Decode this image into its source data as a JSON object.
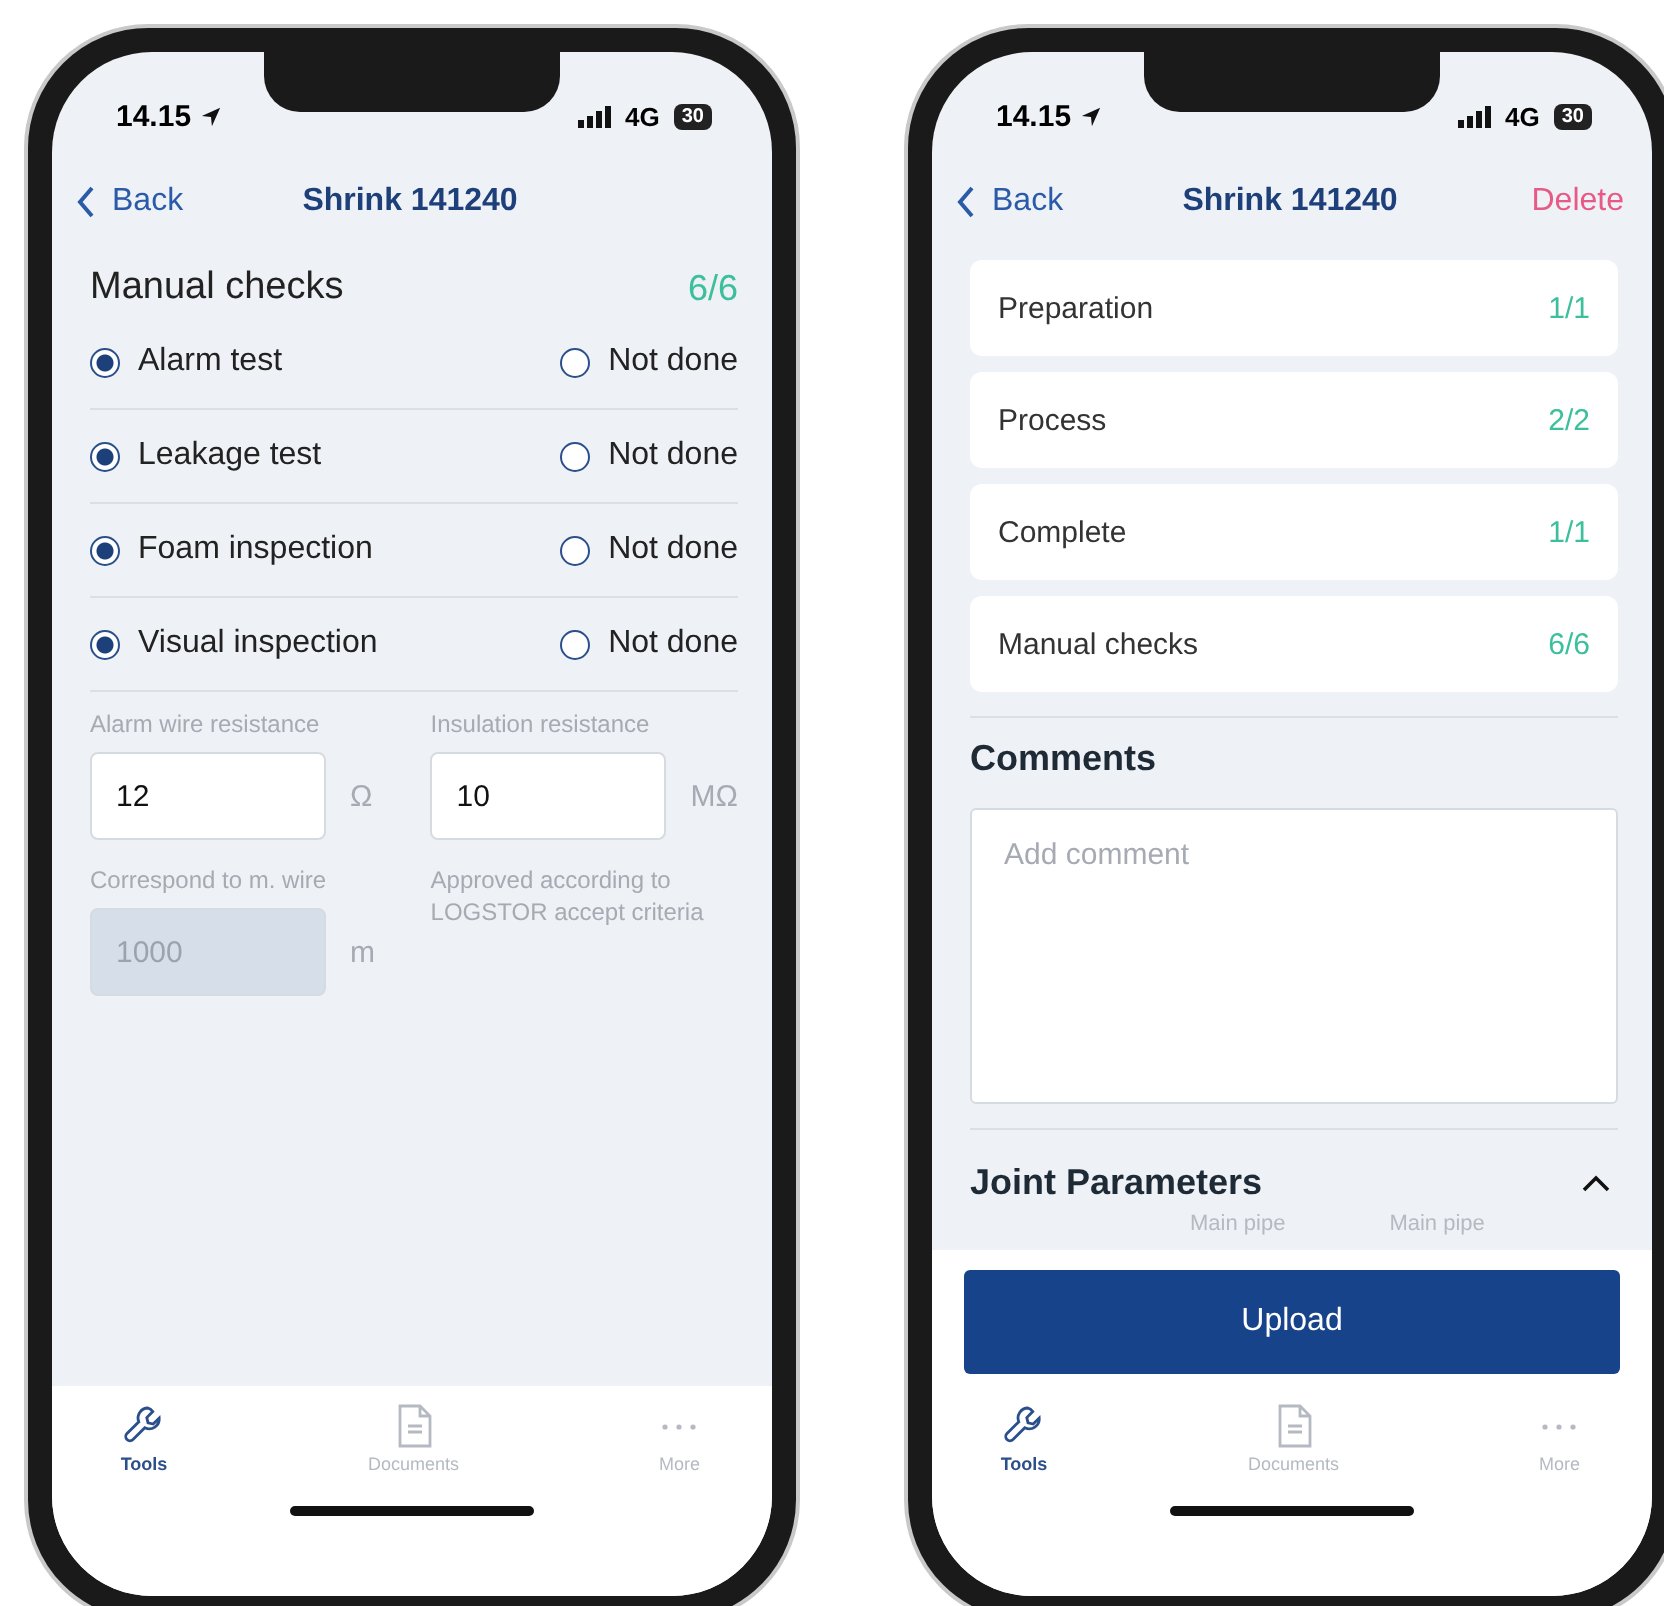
{
  "left_screen": {
    "status": {
      "time": "14.15",
      "network": "4G",
      "battery": "30"
    },
    "nav": {
      "back": "Back",
      "title": "Shrink 141240"
    },
    "section": {
      "title": "Manual checks",
      "count": "6/6"
    },
    "checks": [
      {
        "label": "Alarm test",
        "selected": true,
        "alt_label": "Not done",
        "alt_selected": false
      },
      {
        "label": "Leakage test",
        "selected": true,
        "alt_label": "Not done",
        "alt_selected": false
      },
      {
        "label": "Foam inspection",
        "selected": true,
        "alt_label": "Not done",
        "alt_selected": false
      },
      {
        "label": "Visual inspection",
        "selected": true,
        "alt_label": "Not done",
        "alt_selected": false
      }
    ],
    "fields": [
      {
        "label": "Alarm wire resistance",
        "value": "12",
        "unit": "Ω",
        "disabled": false
      },
      {
        "label": "Insulation resistance",
        "value": "10",
        "unit": "MΩ",
        "disabled": false
      },
      {
        "label": "Correspond to m. wire",
        "value": "1000",
        "unit": "m",
        "disabled": true
      }
    ],
    "note": "Approved according to LOGSTOR accept criteria",
    "tabs": [
      {
        "label": "Tools",
        "selected": true
      },
      {
        "label": "Documents",
        "selected": false
      },
      {
        "label": "More",
        "selected": false
      }
    ]
  },
  "right_screen": {
    "status": {
      "time": "14.15",
      "network": "4G",
      "battery": "30"
    },
    "nav": {
      "back": "Back",
      "title": "Shrink 141240",
      "action": "Delete"
    },
    "steps": [
      {
        "name": "Preparation",
        "count": "1/1"
      },
      {
        "name": "Process",
        "count": "2/2"
      },
      {
        "name": "Complete",
        "count": "1/1"
      },
      {
        "name": "Manual checks",
        "count": "6/6"
      }
    ],
    "comments": {
      "title": "Comments",
      "placeholder": "Add comment"
    },
    "joint_parameters": {
      "title": "Joint Parameters",
      "expanded": true,
      "column_labels": [
        "Main pipe",
        "Main pipe"
      ]
    },
    "upload": "Upload",
    "tabs": [
      {
        "label": "Tools",
        "selected": true
      },
      {
        "label": "Documents",
        "selected": false
      },
      {
        "label": "More",
        "selected": false
      }
    ]
  }
}
